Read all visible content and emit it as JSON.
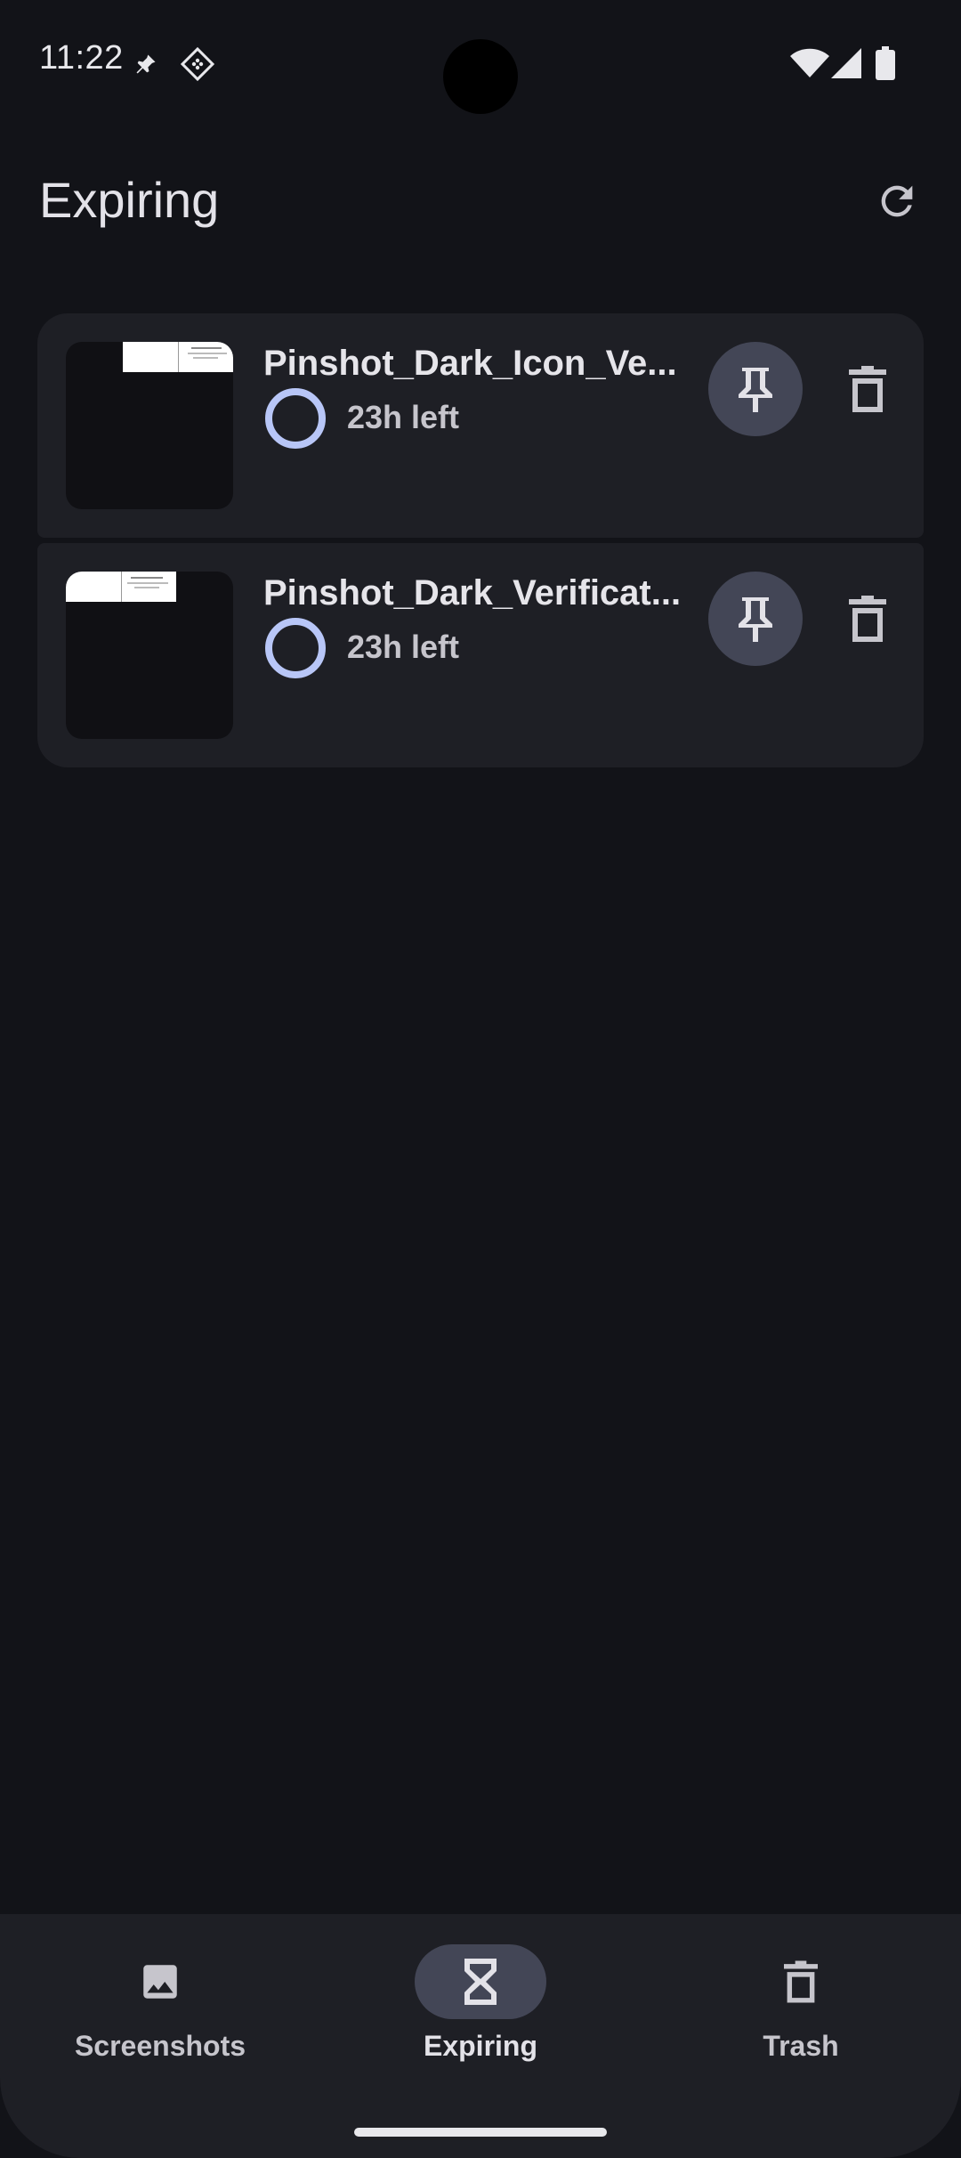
{
  "status_bar": {
    "time": "11:22",
    "icons": [
      "pin-notification-icon",
      "app-notification-icon",
      "wifi-icon",
      "signal-icon",
      "battery-icon"
    ]
  },
  "app_bar": {
    "title": "Expiring",
    "refresh_icon": "refresh-icon"
  },
  "items": [
    {
      "title": "Pinshot_Dark_Icon_Ve...",
      "time_left": "23h left",
      "progress": 1.0
    },
    {
      "title": "Pinshot_Dark_Verificat...",
      "time_left": "23h left",
      "progress": 1.0
    }
  ],
  "bottom_nav": {
    "items": [
      {
        "label": "Screenshots",
        "icon": "image-icon",
        "active": false
      },
      {
        "label": "Expiring",
        "icon": "hourglass-icon",
        "active": true
      },
      {
        "label": "Trash",
        "icon": "trash-icon",
        "active": false
      }
    ]
  },
  "colors": {
    "background": "#121318",
    "surface": "#1e1f25",
    "accent_ring": "#b8c6f7",
    "selected_pill": "#434656"
  }
}
